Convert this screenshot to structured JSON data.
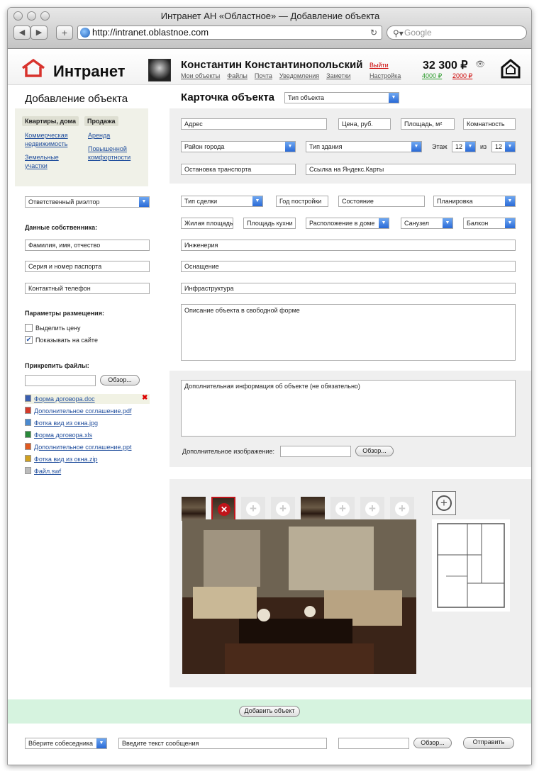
{
  "window": {
    "title": "Интранет АН «Областное» — Добавление объекта",
    "url": "http://intranet.oblastnoe.com",
    "search_placeholder": "Google"
  },
  "header": {
    "logo": "Интранет",
    "user_name": "Константин Константинопольский",
    "nav": [
      "Мои объекты",
      "Файлы",
      "Почта",
      "Уведомления",
      "Заметки"
    ],
    "logout": "Выйти",
    "settings": "Настройка",
    "balance": "32 300 ₽",
    "balance_plus": "4000 ₽",
    "balance_minus": "2000 ₽",
    "colors": {
      "logo_red": "#d8322c",
      "link_blue": "#1f4d9c",
      "plus_green": "#2a9a2a",
      "minus_red": "#cc0000"
    }
  },
  "sidebar": {
    "title": "Добавление объекта",
    "tabs": [
      "Квартиры, дома",
      "Продажа"
    ],
    "categories": [
      "Коммерческая недвижимость",
      "Земельные участки",
      "Аренда",
      "Повышенной комфортности"
    ],
    "realtor_select": "Ответственный риэлтор",
    "owner_title": "Данные собственника:",
    "owner_name": "Фамилия, имя, отчество",
    "owner_passport": "Серия и номер паспорта",
    "owner_phone": "Контактный телефон",
    "placement_title": "Параметры размещения:",
    "placement_options": [
      {
        "label": "Выделить цену",
        "checked": false
      },
      {
        "label": "Показывать на сайте",
        "checked": true
      }
    ],
    "attach_title": "Прикрепить файлы:",
    "browse": "Обзор...",
    "files": [
      {
        "name": "Форма договора.doc",
        "icon": "doc-icon",
        "color": "#3a5fb0"
      },
      {
        "name": "Дополнительное соглашение.pdf",
        "icon": "pdf-icon",
        "color": "#d43a2a"
      },
      {
        "name": "Фотка вид из окна.jpg",
        "icon": "image-icon",
        "color": "#4a8ad0"
      },
      {
        "name": "Форма договора.xls",
        "icon": "xls-icon",
        "color": "#2a8a3a"
      },
      {
        "name": "Дополнительное соглашение.ppt",
        "icon": "ppt-icon",
        "color": "#e05a20"
      },
      {
        "name": "Фотка вид из окна.zip",
        "icon": "zip-icon",
        "color": "#d0a020"
      },
      {
        "name": "Файл.swf",
        "icon": "file-icon",
        "color": "#bbbbbb"
      }
    ]
  },
  "card": {
    "title": "Карточка объекта",
    "type_select": "Тип объекта",
    "address": "Адрес",
    "price": "Цена, руб.",
    "area": "Площадь, м²",
    "rooms": "Комнатность",
    "district": "Район города",
    "building_type": "Тип здания",
    "floor_label": "Этаж",
    "floor_value": "12",
    "of_label": "из",
    "floors_total": "12",
    "transport": "Остановка транспорта",
    "yandex_link": "Ссылка на Яндекс.Карты",
    "deal_type": "Тип сделки",
    "year": "Год постройки",
    "condition": "Состояние",
    "layout": "Планировка",
    "living_area": "Жилая площадь",
    "kitchen_area": "Площадь кухни",
    "house_position": "Расположение в доме",
    "bathroom": "Санузел",
    "balcony": "Балкон",
    "engineering": "Инженерия",
    "equipment": "Оснащение",
    "infrastructure": "Инфраструктура",
    "description": "Описание объекта в свободной форме",
    "extra_info": "Дополнительная информация об объекте (не обязательно)",
    "extra_image_label": "Дополнительное изображение:",
    "browse": "Обзор..."
  },
  "footer": {
    "add_button": "Добавить объект",
    "chat_select": "Вберите собеседника",
    "chat_input": "Введите текст сообщения",
    "browse": "Обзор...",
    "send": "Отправить"
  }
}
